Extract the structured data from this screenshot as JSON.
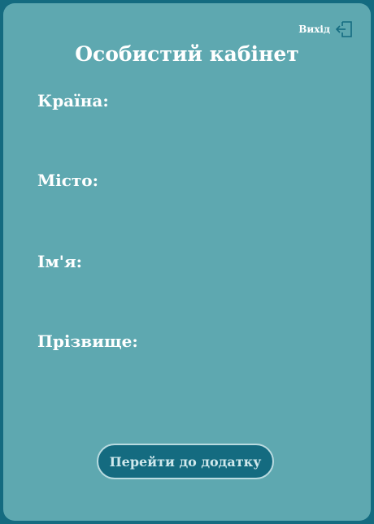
{
  "header": {
    "logout_label": "Вихід",
    "logout_icon": "logout-icon",
    "title": "Особистий кабінет"
  },
  "profile": {
    "fields": [
      {
        "label": "Країна:"
      },
      {
        "label": "Місто:"
      },
      {
        "label": "Ім'я:"
      },
      {
        "label": "Прізвище:"
      }
    ]
  },
  "actions": {
    "go_to_app_label": "Перейти до додатку"
  },
  "colors": {
    "background": "#146b80",
    "panel": "#5ea8b0",
    "button_bg": "#146b80",
    "button_border": "#b9dbe0",
    "text": "#ffffff"
  }
}
